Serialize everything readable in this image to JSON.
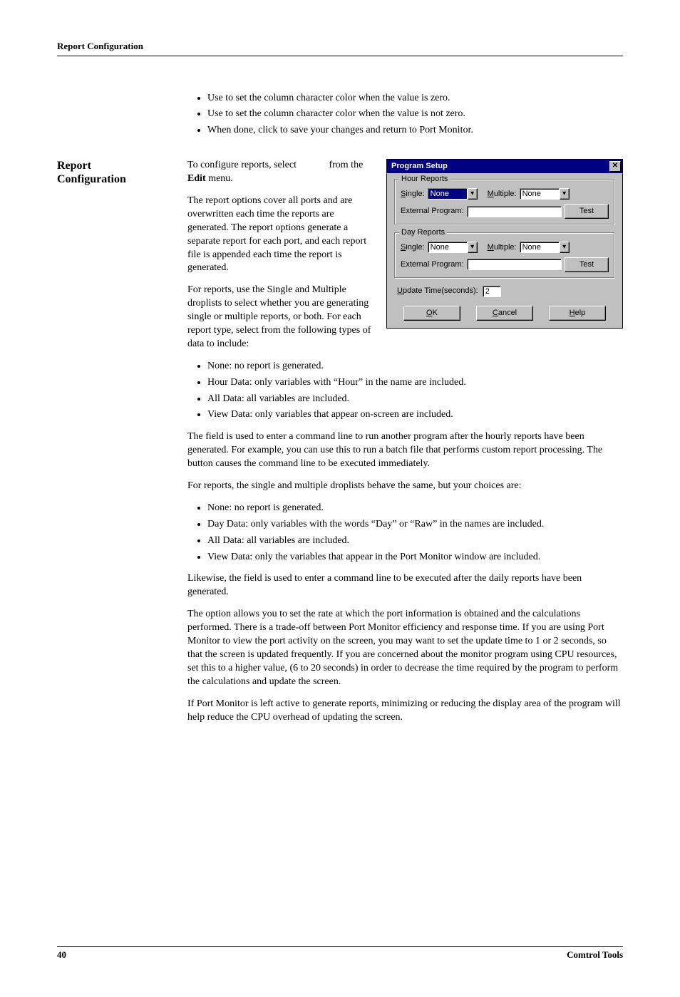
{
  "header": {
    "running_title": "Report Configuration"
  },
  "sidebar": {
    "heading_line1": "Report",
    "heading_line2": "Configuration"
  },
  "intro_bullets": [
    "Use             to set the column character color when the value is zero.",
    "Use             to set the column character color when the value is not zero.",
    "When done, click            to save your changes and return to Port Monitor."
  ],
  "p_intro_1a": "To configure reports, select",
  "p_intro_1b": "from the ",
  "p_intro_1b_bold": "Edit",
  "p_intro_1c": " menu.",
  "p_intro_2": "The             report options cover all ports and are overwritten each time the reports are generated. The                    report options generate a separate report for each port, and each report file is appended each time the report is generated.",
  "p_intro_3": "For             reports, use the Single and Multiple droplists to select whether you are generating single or multiple reports, or both. For each report type, select from the following types of data to include:",
  "hour_bullets": [
    "None: no report is generated.",
    "Hour Data: only variables with “Hour” in the name are included.",
    "All Data: all variables are included.",
    "View Data: only variables that appear on-screen are included."
  ],
  "p_ext1": "The                               field is used to enter a command line to run another program after the hourly reports have been generated. For example, you can use this to run a batch file that performs custom report processing. The            button causes the command line to be executed immediately.",
  "p_day_intro": "For          reports, the single and multiple droplists behave the same, but your choices are:",
  "day_bullets": [
    "None: no report is generated.",
    "Day Data: only variables with the words “Day” or “Raw” in the names are included.",
    "All Data: all variables are included.",
    "View Data: only the variables that appear in the Port Monitor window are included."
  ],
  "p_ext2": "Likewise, the                                   field is used to enter a command line to be executed after the daily reports have been generated.",
  "p_update": "The                          option allows you to set the rate at which the port information is obtained and the calculations performed. There is a trade-off between Port Monitor efficiency and response time. If you are using Port Monitor to view the port activity on the screen, you may want to set the update time to 1 or 2 seconds, so that the screen is updated frequently. If you are concerned about the monitor program using CPU resources, set this to a higher value, (6 to 20 seconds) in order to decrease the time required by the program to perform the calculations and update the screen.",
  "p_final": "If Port Monitor is left active to generate reports, minimizing or reducing the display area of the program will help reduce the CPU overhead of updating the screen.",
  "dialog": {
    "title": "Program Setup",
    "close_glyph": "✕",
    "group_hour": "Hour Reports",
    "group_day": "Day Reports",
    "label_single_u": "S",
    "label_single_rest": "ingle:",
    "label_multiple_u": "M",
    "label_multiple_rest": "ultiple:",
    "hour_single_value": "None",
    "hour_multiple_value": "None",
    "day_single_value": "None",
    "day_multiple_value": "None",
    "label_ext": "External Program:",
    "btn_test": "Test",
    "label_update_u": "U",
    "label_update_rest": "pdate Time(seconds):",
    "update_value": "2",
    "btn_ok_u": "O",
    "btn_ok_rest": "K",
    "btn_cancel_u": "C",
    "btn_cancel_rest": "ancel",
    "btn_help_u": "H",
    "btn_help_rest": "elp",
    "drop_glyph": "▾"
  },
  "footer": {
    "page": "40",
    "right": "Comtrol Tools"
  }
}
